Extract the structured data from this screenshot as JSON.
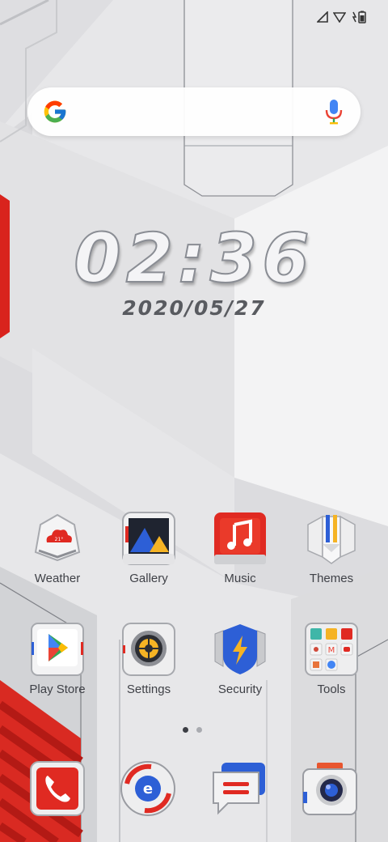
{
  "status_bar": {
    "icons": [
      "signal-icon",
      "wifi-icon",
      "battery-charging-icon"
    ]
  },
  "search_bar": {
    "logo_icon": "google-g-icon",
    "mic_icon": "microphone-icon"
  },
  "clock_widget": {
    "time": "02:36",
    "date": "2020/05/27"
  },
  "weather_icon_temp": "21°",
  "apps_row_1": [
    {
      "label": "Weather",
      "icon": "weather-icon"
    },
    {
      "label": "Gallery",
      "icon": "gallery-icon"
    },
    {
      "label": "Music",
      "icon": "music-icon"
    },
    {
      "label": "Themes",
      "icon": "themes-icon"
    }
  ],
  "apps_row_2": [
    {
      "label": "Play Store",
      "icon": "play-store-icon"
    },
    {
      "label": "Settings",
      "icon": "settings-icon"
    },
    {
      "label": "Security",
      "icon": "security-icon"
    },
    {
      "label": "Tools",
      "icon": "tools-folder-icon"
    }
  ],
  "page_indicator": {
    "pages": 2,
    "current": 1
  },
  "dock": [
    {
      "icon": "phone-icon"
    },
    {
      "icon": "browser-icon"
    },
    {
      "icon": "messages-icon"
    },
    {
      "icon": "camera-icon"
    }
  ],
  "colors": {
    "accent_red": "#e02a22",
    "accent_blue": "#2d5fd6",
    "panel_grey": "#e9e9ea",
    "text": "#3f4147"
  }
}
